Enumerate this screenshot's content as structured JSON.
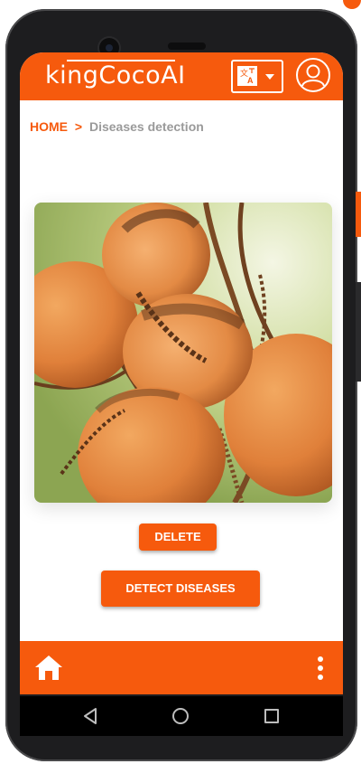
{
  "app": {
    "logo_text": "kingCocoAI",
    "brand_color": "#f65a0d"
  },
  "header": {
    "translate_icon": "translate-icon",
    "dropdown_icon": "caret-down-icon",
    "profile_icon": "user-circle-icon"
  },
  "breadcrumb": {
    "home": "HOME",
    "separator": ">",
    "current": "Diseases detection"
  },
  "image": {
    "subject": "cluster of orange king coconuts"
  },
  "actions": {
    "delete_label": "DELETE",
    "detect_label": "DETECT DISEASES"
  },
  "footer": {
    "home_icon": "home-icon",
    "menu_icon": "more-vertical-icon"
  },
  "system_nav": {
    "back": "back-icon",
    "home": "home-circle-icon",
    "recents": "recents-icon"
  }
}
